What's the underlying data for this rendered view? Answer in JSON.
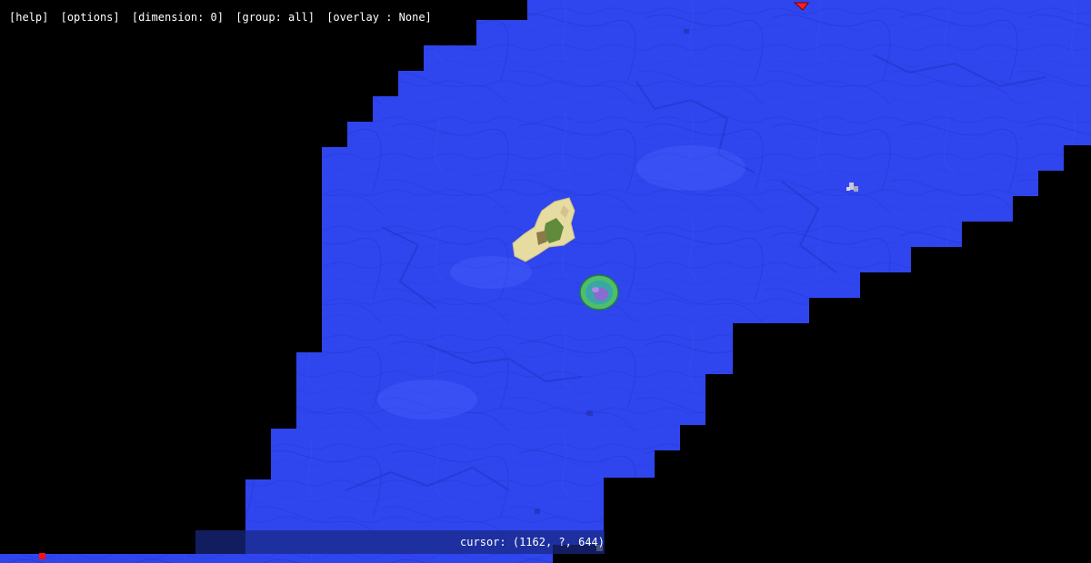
{
  "menu": {
    "help": "[help]",
    "options": "[options]",
    "dimension": "[dimension: 0]",
    "group": "[group: all]",
    "overlay": "[overlay : None]"
  },
  "status": {
    "cursor_text": "cursor: (1162, ?, 644)"
  },
  "colors": {
    "ocean": "#2f45ee",
    "deep_ocean": "#2438d6",
    "unexplored": "#000000",
    "sand": "#e6dba0",
    "status_bar": "#182882",
    "player_marker": "#ff1010",
    "waypoint_marker": "#ff1e1e"
  },
  "icons": {
    "player_marker": "player-marker-icon",
    "waypoint_marker": "waypoint-arrow-icon",
    "mushroom_island": "mushroom-island-icon"
  }
}
